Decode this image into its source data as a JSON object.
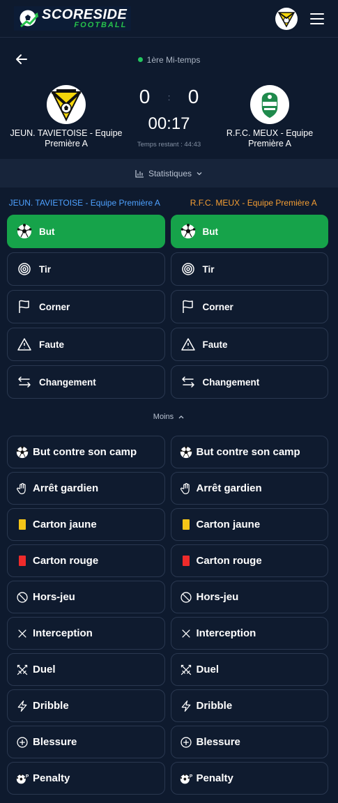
{
  "app": {
    "logo_title": "SCORESIDE",
    "logo_sub": "FOOTBALL"
  },
  "match": {
    "period": "1ère Mi-temps",
    "home_team": "JEUN. TAVIETOISE - Equipe Première A",
    "away_team": "R.F.C. MEUX - Equipe Première A",
    "home_score": "0",
    "away_score": "0",
    "score_separator": ":",
    "clock": "00:17",
    "remaining": "Temps restant : 44:43"
  },
  "stats": {
    "label": "Statistiques"
  },
  "columns": {
    "home_label": "JEUN. TAVIETOISE - Equipe Première A",
    "away_label": "R.F.C. MEUX - Equipe Première A"
  },
  "primary_actions": [
    {
      "label": "But",
      "icon": "soccer-ball-icon"
    },
    {
      "label": "Tir",
      "icon": "target-icon"
    },
    {
      "label": "Corner",
      "icon": "flag-icon"
    },
    {
      "label": "Faute",
      "icon": "warning-icon"
    },
    {
      "label": "Changement",
      "icon": "swap-icon"
    }
  ],
  "toggle": {
    "label": "Moins"
  },
  "secondary_actions": [
    {
      "label": "But contre son camp",
      "icon": "soccer-ball-icon"
    },
    {
      "label": "Arrêt gardien",
      "icon": "hand-icon"
    },
    {
      "label": "Carton jaune",
      "icon": "yellow-card-icon"
    },
    {
      "label": "Carton rouge",
      "icon": "red-card-icon"
    },
    {
      "label": "Hors-jeu",
      "icon": "ban-icon"
    },
    {
      "label": "Interception",
      "icon": "x-icon"
    },
    {
      "label": "Duel",
      "icon": "swords-icon"
    },
    {
      "label": "Dribble",
      "icon": "bolt-icon"
    },
    {
      "label": "Blessure",
      "icon": "plus-circle-icon"
    },
    {
      "label": "Penalty",
      "icon": "penalty-ball-icon"
    }
  ],
  "colors": {
    "background": "#0e1a2e",
    "active_green": "#16a34a",
    "home_blue": "#4ea1ff",
    "away_orange": "#f59e33"
  }
}
